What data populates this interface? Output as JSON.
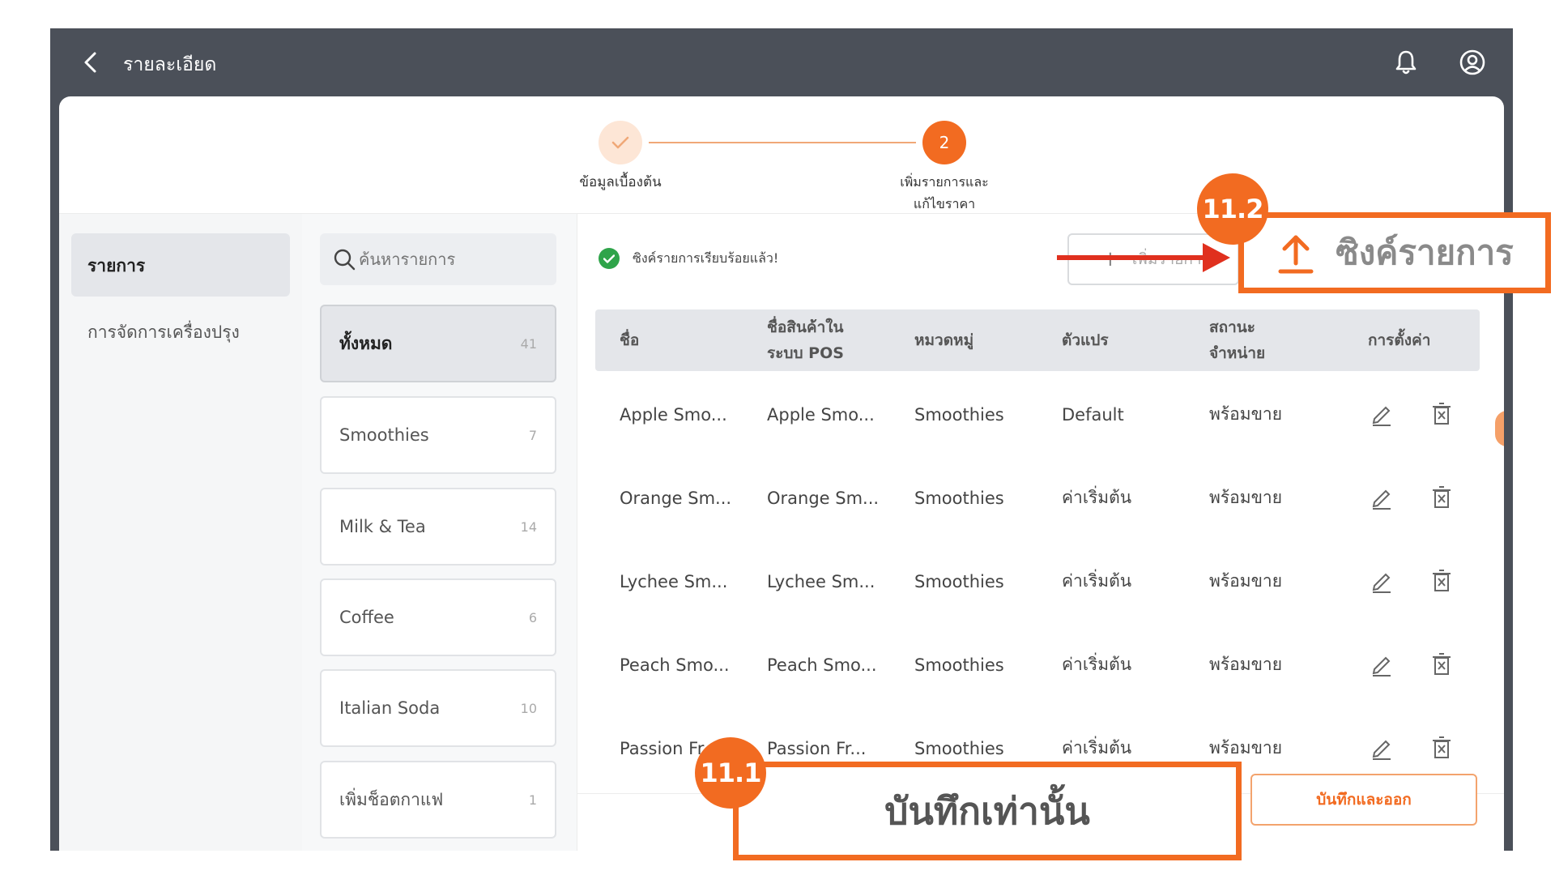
{
  "topbar": {
    "title": "รายละเอียด"
  },
  "stepper": {
    "step1_label": "ข้อมูลเบื้องต้น",
    "step2_number": "2",
    "step2_label_line1": "เพิ่มรายการและ",
    "step2_label_line2": "แก้ไขราคา"
  },
  "sidebar": {
    "items": [
      {
        "label": "รายการ",
        "active": true
      },
      {
        "label": "การจัดการเครื่องปรุง",
        "active": false
      }
    ]
  },
  "search": {
    "placeholder": "ค้นหารายการ"
  },
  "categories": [
    {
      "name": "ทั้งหมด",
      "count": "41"
    },
    {
      "name": "Smoothies",
      "count": "7"
    },
    {
      "name": "Milk & Tea",
      "count": "14"
    },
    {
      "name": "Coffee",
      "count": "6"
    },
    {
      "name": "Italian Soda",
      "count": "10"
    },
    {
      "name": "เพิ่มช็อตกาแฟ",
      "count": "1"
    }
  ],
  "status": {
    "sync_message": "ซิงค์รายการเรียบร้อยแล้ว!"
  },
  "toolbar": {
    "add_label": "เพิ่มรายการ"
  },
  "table": {
    "headers": {
      "name": "ชื่อ",
      "pos_name_line1": "ชื่อสินค้าใน",
      "pos_name_line2": "ระบบ POS",
      "category": "หมวดหมู่",
      "variant": "ตัวแปร",
      "status_line1": "สถานะ",
      "status_line2": "จำหน่าย",
      "settings": "การตั้งค่า"
    },
    "rows": [
      {
        "name": "Apple Smo...",
        "pos_name": "Apple Smo...",
        "category": "Smoothies",
        "variant": "Default",
        "status": "พร้อมขาย"
      },
      {
        "name": "Orange Sm...",
        "pos_name": "Orange Sm...",
        "category": "Smoothies",
        "variant": "ค่าเริ่มต้น",
        "status": "พร้อมขาย"
      },
      {
        "name": "Lychee Sm...",
        "pos_name": "Lychee Sm...",
        "category": "Smoothies",
        "variant": "ค่าเริ่มต้น",
        "status": "พร้อมขาย"
      },
      {
        "name": "Peach Smo...",
        "pos_name": "Peach Smo...",
        "category": "Smoothies",
        "variant": "ค่าเริ่มต้น",
        "status": "พร้อมขาย"
      },
      {
        "name": "Passion Fr...",
        "pos_name": "Passion Fr...",
        "category": "Smoothies",
        "variant": "ค่าเริ่มต้น",
        "status": "พร้อมขาย"
      }
    ]
  },
  "footer": {
    "save_exit_label": "บันทึกและออก"
  },
  "annotations": {
    "sync_badge": "11.2",
    "sync_label": "ซิงค์รายการ",
    "save_badge": "11.1",
    "save_label": "บันทึกเท่านั้น"
  },
  "colors": {
    "accent": "#f26b21",
    "topbar": "#4b5059",
    "success": "#2fa44a",
    "arrow": "#e0301e"
  },
  "icons": [
    "back-arrow-icon",
    "bell-icon",
    "user-circle-icon",
    "check-icon",
    "search-icon",
    "plus-icon",
    "edit-icon",
    "delete-icon",
    "upload-icon"
  ]
}
